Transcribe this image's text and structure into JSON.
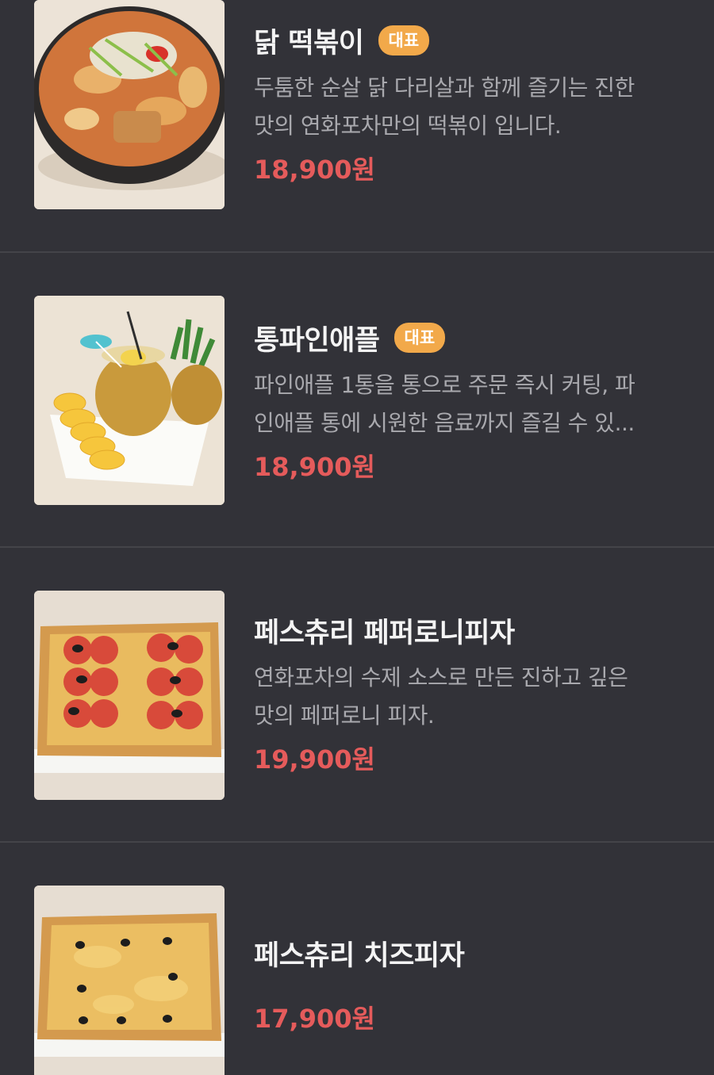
{
  "menu": {
    "items": [
      {
        "name": "닭 떡볶이",
        "badge": "대표",
        "desc_line1": "두툼한 순살 닭 다리살과 함께 즐기는 진한",
        "desc_line2": "맛의 연화포차만의 떡볶이 입니다.",
        "price": "18,900원"
      },
      {
        "name": "통파인애플",
        "badge": "대표",
        "desc_line1": "파인애플 1통을 통으로 주문 즉시 커팅, 파",
        "desc_line2": "인애플 통에 시원한 음료까지 즐길 수 있...",
        "price": "18,900원"
      },
      {
        "name": "페스츄리 페퍼로니피자",
        "desc_line1": "연화포차의 수제 소스로 만든 진하고 깊은",
        "desc_line2": "맛의 페퍼로니 피자.",
        "price": "19,900원"
      },
      {
        "name": "페스츄리 치즈피자",
        "price": "17,900원"
      }
    ]
  },
  "colors": {
    "background": "#323238",
    "badge": "#f2a94a",
    "price": "#e55b5b",
    "description": "#a9a9ae"
  }
}
